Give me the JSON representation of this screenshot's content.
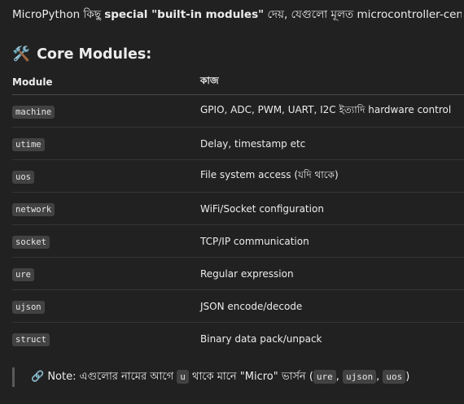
{
  "intro": {
    "prefix": "MicroPython কিছু ",
    "bold": "special \"built-in modules\"",
    "suffix": " দেয়, যেগুলো মূলত microcontroller-centric:"
  },
  "heading": {
    "icon": "🛠️",
    "icon_name": "hammer-wrench-icon",
    "text": "Core Modules:"
  },
  "table": {
    "headers": [
      "Module",
      "কাজ"
    ],
    "rows": [
      {
        "module": "machine",
        "task": "GPIO, ADC, PWM, UART, I2C ইত্যাদি hardware control"
      },
      {
        "module": "utime",
        "task": "Delay, timestamp etc"
      },
      {
        "module": "uos",
        "task": "File system access (যদি থাকে)"
      },
      {
        "module": "network",
        "task": "WiFi/Socket configuration"
      },
      {
        "module": "socket",
        "task": "TCP/IP communication"
      },
      {
        "module": "ure",
        "task": "Regular expression"
      },
      {
        "module": "ujson",
        "task": "JSON encode/decode"
      },
      {
        "module": "struct",
        "task": "Binary data pack/unpack"
      }
    ]
  },
  "note": {
    "icon": "🔗",
    "icon_name": "link-icon",
    "label": "Note: এগুলোর নামের আগে ",
    "code_u": "u",
    "middle": " থাকে মানে \"Micro\" ভার্সন (",
    "code1": "ure",
    "sep1": ", ",
    "code2": "ujson",
    "sep2": ", ",
    "code3": "uos",
    "end": ")"
  }
}
